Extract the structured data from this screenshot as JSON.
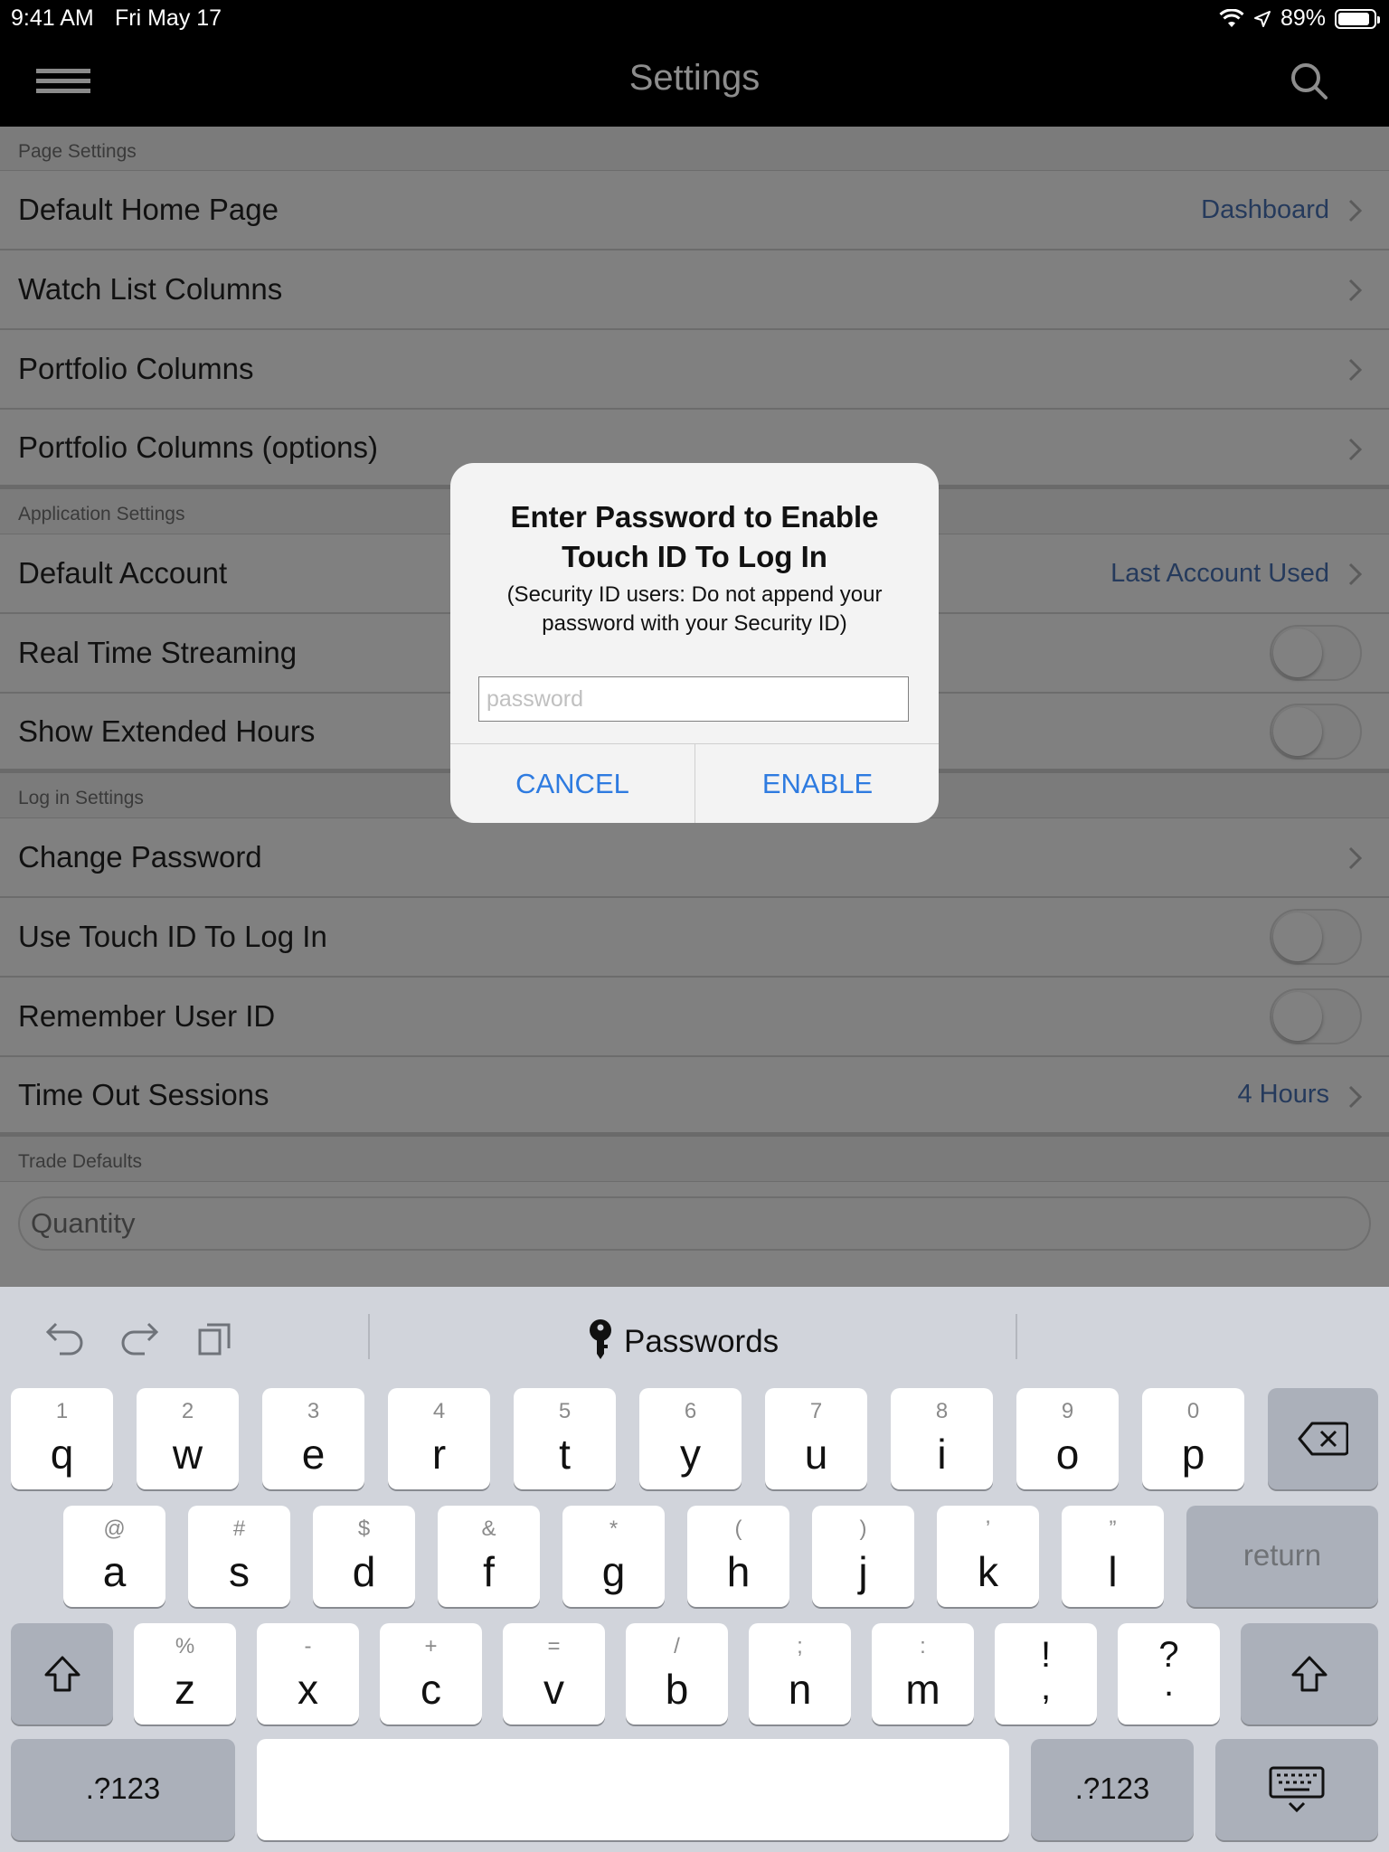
{
  "status_bar": {
    "time": "9:41 AM",
    "date": "Fri May 17",
    "battery": "89%"
  },
  "nav": {
    "title": "Settings"
  },
  "sections": {
    "page": {
      "header": "Page Settings",
      "default_home_page": {
        "label": "Default Home Page",
        "value": "Dashboard"
      },
      "watch_list_columns": {
        "label": "Watch List Columns"
      },
      "portfolio_columns": {
        "label": "Portfolio Columns"
      },
      "portfolio_columns_options": {
        "label": "Portfolio Columns (options)"
      }
    },
    "application": {
      "header": "Application Settings",
      "default_account": {
        "label": "Default Account",
        "value": "Last Account Used"
      },
      "real_time_streaming": {
        "label": "Real Time Streaming",
        "on": false
      },
      "show_extended_hours": {
        "label": "Show Extended Hours",
        "on": false
      }
    },
    "login": {
      "header": "Log in Settings",
      "change_password": {
        "label": "Change Password"
      },
      "use_touch_id": {
        "label": "Use Touch ID To Log In",
        "on": false
      },
      "remember_user_id": {
        "label": "Remember User ID",
        "on": false
      },
      "time_out_sessions": {
        "label": "Time Out Sessions",
        "value": "4 Hours"
      }
    },
    "trade": {
      "header": "Trade Defaults",
      "quantity_placeholder": "Quantity"
    }
  },
  "dialog": {
    "title": "Enter Password to Enable Touch ID To Log In",
    "message": "(Security ID users: Do not append your password with your Security ID)",
    "input_placeholder": "password",
    "cancel": "CANCEL",
    "enable": "ENABLE"
  },
  "keyboard": {
    "toolbar": {
      "passwords": "Passwords"
    },
    "row1": [
      {
        "hint": "1",
        "key": "q"
      },
      {
        "hint": "2",
        "key": "w"
      },
      {
        "hint": "3",
        "key": "e"
      },
      {
        "hint": "4",
        "key": "r"
      },
      {
        "hint": "5",
        "key": "t"
      },
      {
        "hint": "6",
        "key": "y"
      },
      {
        "hint": "7",
        "key": "u"
      },
      {
        "hint": "8",
        "key": "i"
      },
      {
        "hint": "9",
        "key": "o"
      },
      {
        "hint": "0",
        "key": "p"
      }
    ],
    "row2": [
      {
        "hint": "@",
        "key": "a"
      },
      {
        "hint": "#",
        "key": "s"
      },
      {
        "hint": "$",
        "key": "d"
      },
      {
        "hint": "&",
        "key": "f"
      },
      {
        "hint": "*",
        "key": "g"
      },
      {
        "hint": "(",
        "key": "h"
      },
      {
        "hint": ")",
        "key": "j"
      },
      {
        "hint": "’",
        "key": "k"
      },
      {
        "hint": "”",
        "key": "l"
      }
    ],
    "row3": [
      {
        "hint": "%",
        "key": "z"
      },
      {
        "hint": "-",
        "key": "x"
      },
      {
        "hint": "+",
        "key": "c"
      },
      {
        "hint": "=",
        "key": "v"
      },
      {
        "hint": "/",
        "key": "b"
      },
      {
        "hint": ";",
        "key": "n"
      },
      {
        "hint": ":",
        "key": "m"
      }
    ],
    "sym1": {
      "top": "!",
      "bottom": ","
    },
    "sym2": {
      "top": "?",
      "bottom": "."
    },
    "return": "return",
    "numbers": ".?123"
  },
  "colors": {
    "accent": "#2e7be0",
    "value_text": "#253a5c",
    "overlay_bg": "#808080"
  }
}
